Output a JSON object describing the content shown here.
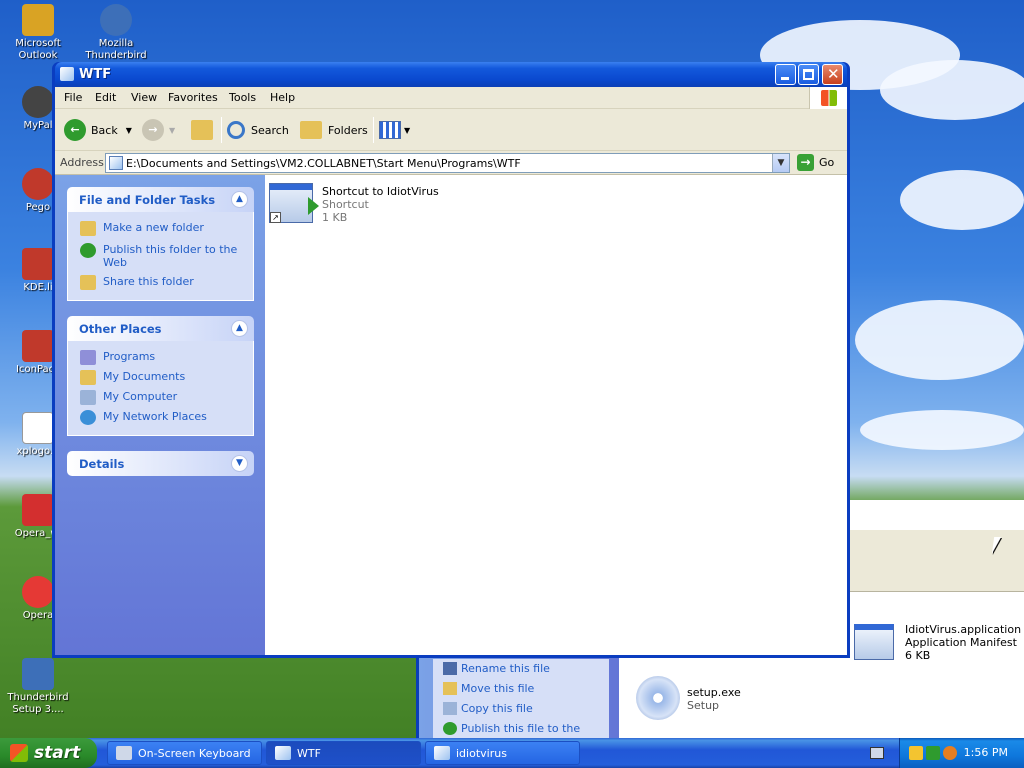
{
  "desktop": {
    "icons": [
      {
        "label": "Microsoft Outlook",
        "color": "#d9a324"
      },
      {
        "label": "Mozilla Thunderbird",
        "color": "#3d6fb8"
      },
      {
        "label": "MyPal",
        "color": "#444444"
      },
      {
        "label": "Pego",
        "color": "#c0392b"
      },
      {
        "label": "KDE.li",
        "color": "#c0392b"
      },
      {
        "label": "IconPack",
        "color": "#c0392b"
      },
      {
        "label": "xplogo.p",
        "color": "#ffffff"
      },
      {
        "label": "Opera_wi",
        "color": "#d32f2f"
      },
      {
        "label": "Opera",
        "color": "#e53935"
      },
      {
        "label": "Thunderbird Setup 3....",
        "color": "#3d6fb8"
      }
    ]
  },
  "background_window": {
    "tasks": [
      {
        "label": "Rename this file",
        "icon": "rename-icon"
      },
      {
        "label": "Move this file",
        "icon": "move-icon"
      },
      {
        "label": "Copy this file",
        "icon": "copy-icon"
      },
      {
        "label": "Publish this file to the Web",
        "icon": "globe-icon"
      }
    ],
    "files": [
      {
        "name": "IdiotVirus.application",
        "type": "Application Manifest",
        "size": "6 KB"
      },
      {
        "name": "setup.exe",
        "type": "Setup"
      }
    ]
  },
  "window": {
    "title": "WTF",
    "menu": [
      "File",
      "Edit",
      "View",
      "Favorites",
      "Tools",
      "Help"
    ],
    "toolbar": {
      "back_label": "Back",
      "search_label": "Search",
      "folders_label": "Folders"
    },
    "address": {
      "label": "Address",
      "value": "E:\\Documents and Settings\\VM2.COLLABNET\\Start Menu\\Programs\\WTF",
      "go_label": "Go"
    },
    "panels": {
      "file_tasks": {
        "title": "File and Folder Tasks",
        "items": [
          {
            "label": "Make a new folder",
            "icon": "new-folder-icon"
          },
          {
            "label": "Publish this folder to the Web",
            "icon": "globe-icon"
          },
          {
            "label": "Share this folder",
            "icon": "share-folder-icon"
          }
        ]
      },
      "other_places": {
        "title": "Other Places",
        "items": [
          {
            "label": "Programs",
            "icon": "programs-folder-icon"
          },
          {
            "label": "My Documents",
            "icon": "my-documents-icon"
          },
          {
            "label": "My Computer",
            "icon": "my-computer-icon"
          },
          {
            "label": "My Network Places",
            "icon": "network-places-icon"
          }
        ]
      },
      "details": {
        "title": "Details"
      }
    },
    "files": [
      {
        "name": "Shortcut to IdiotVirus",
        "type": "Shortcut",
        "size": "1 KB"
      }
    ]
  },
  "taskbar": {
    "start_label": "start",
    "buttons": [
      {
        "label": "On-Screen Keyboard"
      },
      {
        "label": "WTF"
      },
      {
        "label": "idiotvirus"
      }
    ],
    "clock": "1:56 PM"
  },
  "colors": {
    "link_blue": "#215dc6",
    "title_blue": "#0a49cf",
    "start_green": "#2a8a2a"
  }
}
